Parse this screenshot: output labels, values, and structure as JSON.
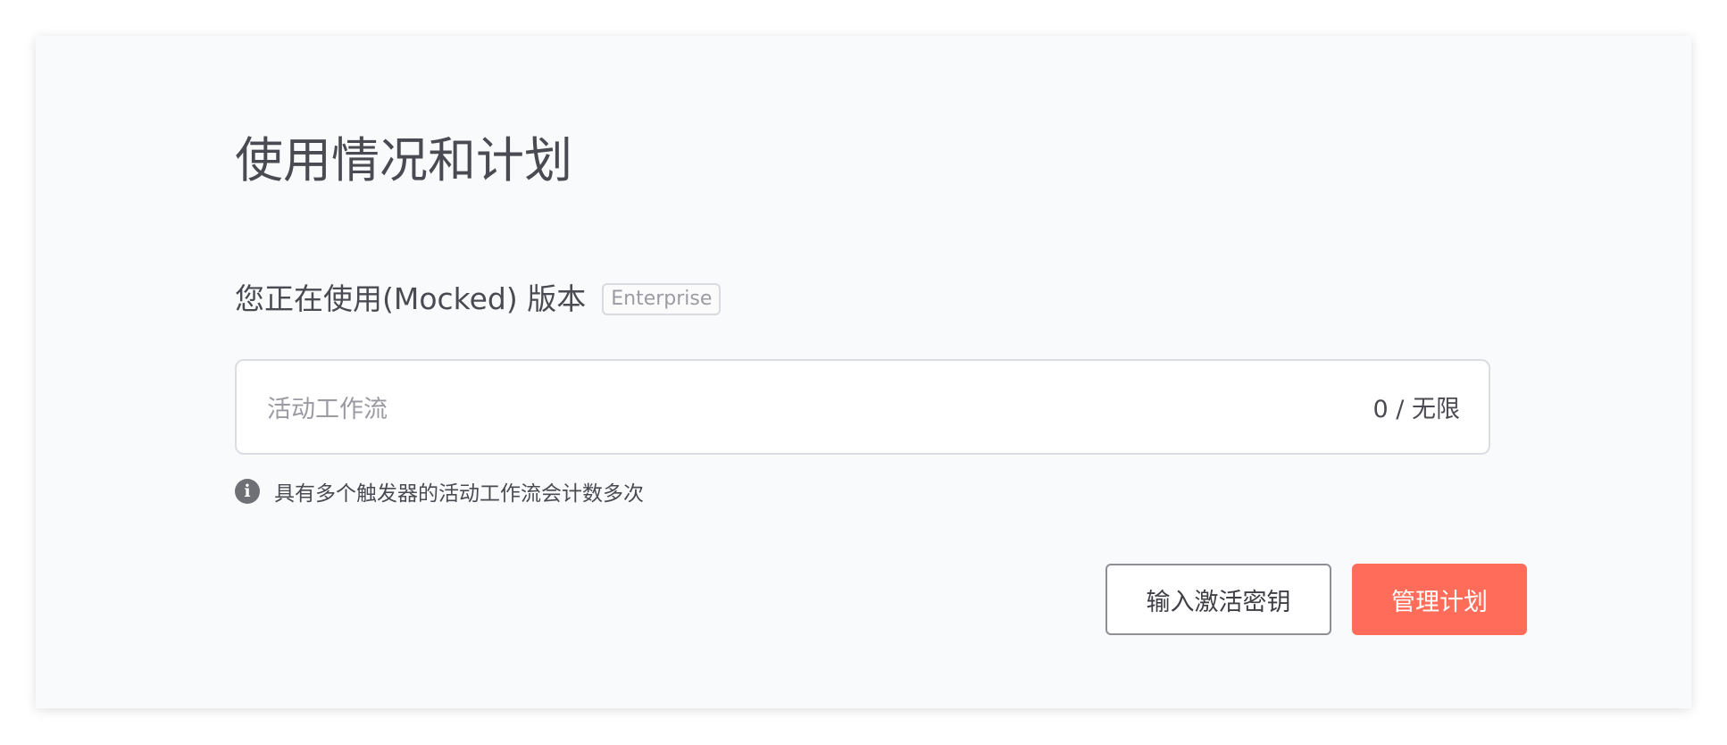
{
  "page": {
    "title": "使用情况和计划"
  },
  "plan": {
    "text": "您正在使用(Mocked) 版本",
    "badge": "Enterprise"
  },
  "usage": {
    "label": "活动工作流",
    "value": "0 / 无限"
  },
  "info": {
    "icon": "info-icon",
    "text": "具有多个触发器的活动工作流会计数多次"
  },
  "actions": {
    "enter_key_label": "输入激活密钥",
    "manage_plan_label": "管理计划"
  },
  "colors": {
    "primary": "#ff6d5a",
    "text": "#4a4a52",
    "muted": "#9b9ba3",
    "background": "#f9fafc"
  }
}
